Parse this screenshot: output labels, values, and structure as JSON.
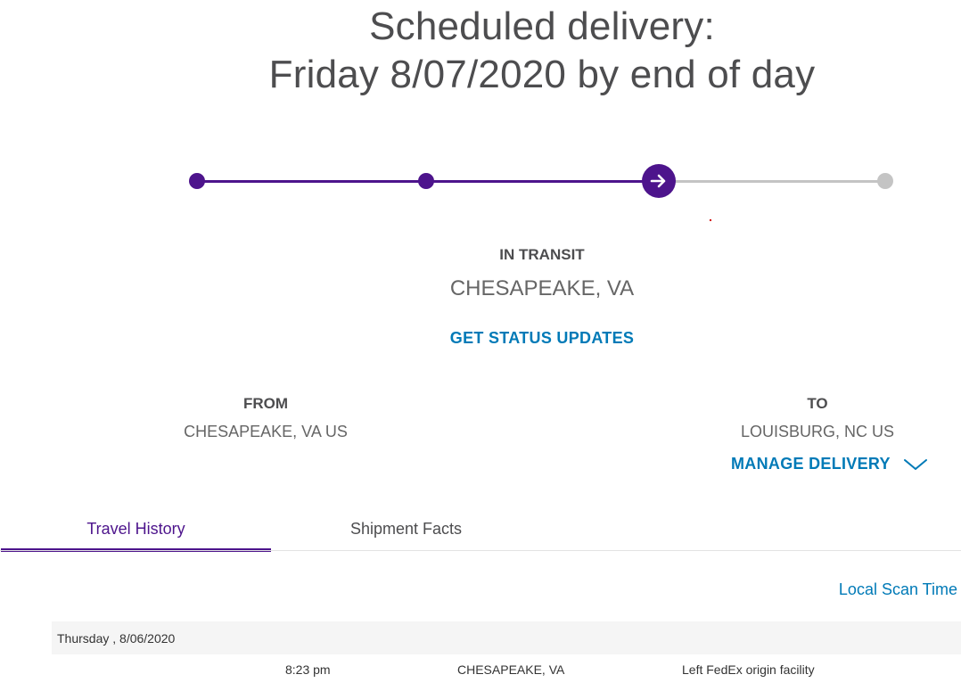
{
  "header": {
    "line1": "Scheduled delivery:",
    "line2": "Friday 8/07/2020 by end of day"
  },
  "progress": {
    "steps_total": 4,
    "current_step": 3,
    "accent_color": "#4d148c",
    "inactive_color": "#c4c4c4",
    "current_icon": "arrow-right-icon"
  },
  "status": {
    "label": "IN TRANSIT",
    "location": "CHESAPEAKE, VA",
    "link": "GET STATUS UPDATES"
  },
  "from": {
    "heading": "FROM",
    "value": "CHESAPEAKE, VA US"
  },
  "to": {
    "heading": "TO",
    "value": "LOUISBURG, NC US"
  },
  "manage": {
    "label": "MANAGE DELIVERY",
    "icon": "chevron-down-icon",
    "link_color": "#007ab7"
  },
  "tabs": [
    {
      "label": "Travel History",
      "active": true
    },
    {
      "label": "Shipment Facts",
      "active": false
    }
  ],
  "history": {
    "scan_time_label": "Local Scan Time",
    "days": [
      {
        "date": "Thursday , 8/06/2020",
        "events": [
          {
            "time": "8:23 pm",
            "location": "CHESAPEAKE, VA",
            "description": "Left FedEx origin facility"
          }
        ]
      }
    ]
  }
}
